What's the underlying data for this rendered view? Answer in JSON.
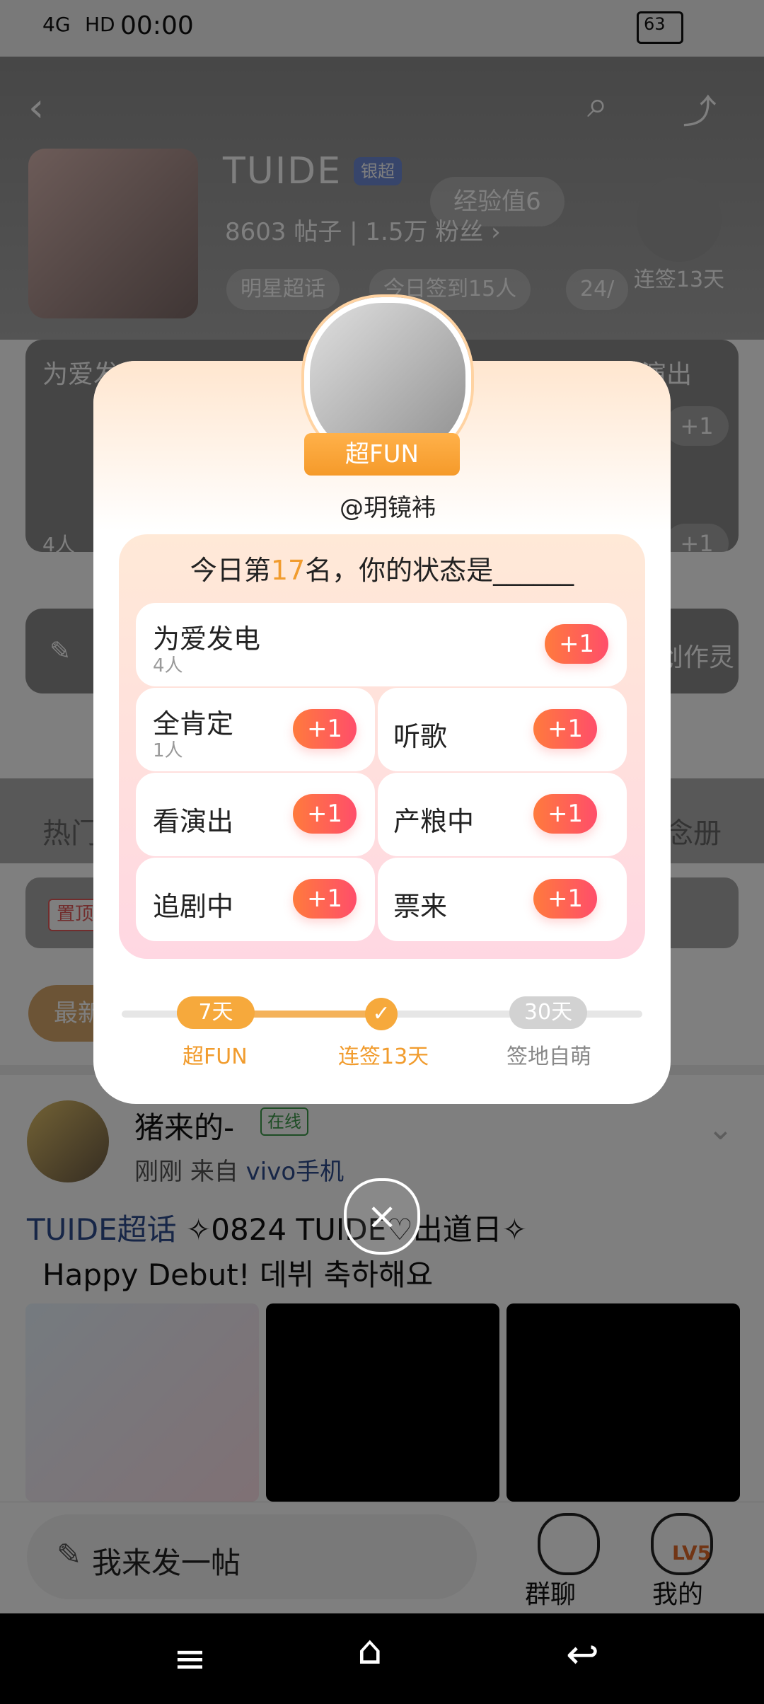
{
  "status_bar": {
    "time": "00:00",
    "signal": "4G",
    "hd": "HD",
    "battery": "63"
  },
  "community": {
    "name": "TUIDE",
    "badge": "银超",
    "posts": "8603 帖子",
    "fans": "1.5万 粉丝",
    "xp_label": "经验值6",
    "streak_label": "连签13天",
    "tags": [
      "明星超话",
      "今日签到15人",
      "24/"
    ]
  },
  "feed_background": {
    "strip_left": "为爱发电",
    "strip_right": "看演出",
    "people_count": "4人",
    "plus_one": "+1",
    "creative": "创作灵",
    "tabs": [
      "热门",
      "念册"
    ],
    "pinned": "置顶",
    "latest": "最新"
  },
  "post": {
    "user": "猪来的-",
    "online": "在线",
    "time": "刚刚",
    "source_prefix": "来自",
    "source": "vivo手机",
    "topic": "TUIDE超话",
    "title": "✧0824 TUIDE♡出道日✧",
    "subtitle": "Happy Debut! 데뷔 축하해요"
  },
  "bottom_bar": {
    "compose_placeholder": "我来发一帖",
    "group_chat": "群聊",
    "mine": "我的",
    "level": "LV5"
  },
  "modal": {
    "handle": "@玥镜袆",
    "badge": "超FUN",
    "prompt_prefix": "今日第",
    "rank": "17",
    "prompt_suffix": "名，你的状态是______",
    "options": [
      {
        "label": "为爱发电",
        "count": "4人",
        "button": "+1"
      },
      {
        "label": "全肯定",
        "count": "1人",
        "button": "+1"
      },
      {
        "label": "听歌",
        "count": "",
        "button": "+1"
      },
      {
        "label": "看演出",
        "count": "",
        "button": "+1"
      },
      {
        "label": "产粮中",
        "count": "",
        "button": "+1"
      },
      {
        "label": "追剧中",
        "count": "",
        "button": "+1"
      },
      {
        "label": "票来",
        "count": "",
        "button": "+1"
      }
    ],
    "progress": {
      "milestones": [
        {
          "pill": "7天",
          "label": "超FUN"
        },
        {
          "pill": "✓",
          "label": "连签13天"
        },
        {
          "pill": "30天",
          "label": "签地自萌"
        }
      ]
    }
  },
  "icons": {
    "back": "chevron-left-icon",
    "search": "search-icon",
    "share": "share-icon",
    "close": "close-icon",
    "pencil": "pencil-icon",
    "group": "group-icon",
    "user": "user-icon",
    "menu": "menu-icon",
    "home": "home-icon",
    "back_nav": "return-icon"
  },
  "colors": {
    "accent_orange": "#f19c2e",
    "button_gradient_start": "#ff7a3d",
    "button_gradient_end": "#ff4e6a"
  }
}
